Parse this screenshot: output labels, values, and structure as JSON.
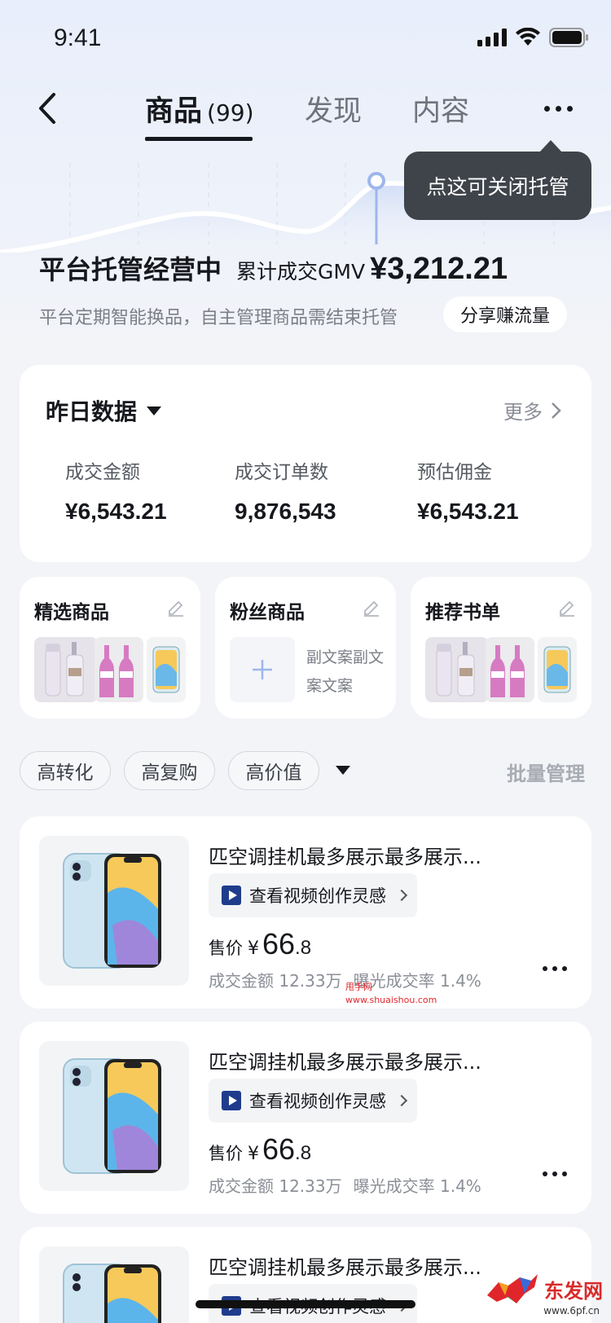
{
  "status_bar": {
    "time": "9:41"
  },
  "nav": {
    "tabs": [
      {
        "label": "商品",
        "count": "(99)"
      },
      {
        "label": "发现"
      },
      {
        "label": "内容"
      }
    ]
  },
  "tooltip": {
    "text": "点这可关闭托管"
  },
  "hero": {
    "title": "平台托管经营中",
    "gmv_label": "累计成交GMV",
    "gmv_value": "¥3,212.21",
    "subtitle": "平台定期智能换品，自主管理商品需结束托管",
    "share_label": "分享赚流量"
  },
  "data_card": {
    "title": "昨日数据",
    "more_label": "更多",
    "metrics": [
      {
        "label": "成交金额",
        "value": "¥6,543.21"
      },
      {
        "label": "成交订单数",
        "value": "9,876,543"
      },
      {
        "label": "预估佣金",
        "value": "¥6,543.21"
      }
    ]
  },
  "collections": [
    {
      "title": "精选商品"
    },
    {
      "title": "粉丝商品",
      "add_text": "副文案副文案文案"
    },
    {
      "title": "推荐书单"
    }
  ],
  "filters": {
    "chips": [
      "高转化",
      "高复购",
      "高价值"
    ],
    "batch_label": "批量管理"
  },
  "products": [
    {
      "title": "匹空调挂机最多展示最多展示...",
      "video_label": "查看视频创作灵感",
      "price_label": "售价",
      "price_symbol": "¥",
      "price_int": "66",
      "price_dec": ".8",
      "stat1": "成交金额 12.33万",
      "stat2": "曝光成交率 1.4%"
    },
    {
      "title": "匹空调挂机最多展示最多展示...",
      "video_label": "查看视频创作灵感",
      "price_label": "售价",
      "price_symbol": "¥",
      "price_int": "66",
      "price_dec": ".8",
      "stat1": "成交金额 12.33万",
      "stat2": "曝光成交率 1.4%"
    },
    {
      "title": "匹空调挂机最多展示最多展示...",
      "video_label": "查看视频创作灵感"
    }
  ],
  "watermark": {
    "line1": "甩手网",
    "line2": "www.shuaishou.com"
  },
  "brand": {
    "name": "东发网",
    "url": "www.6pf.cn"
  },
  "colors": {
    "accent": "#1f3c8c",
    "tooltip_bg": "#3f434a",
    "page_bg": "#f3f4f7"
  }
}
